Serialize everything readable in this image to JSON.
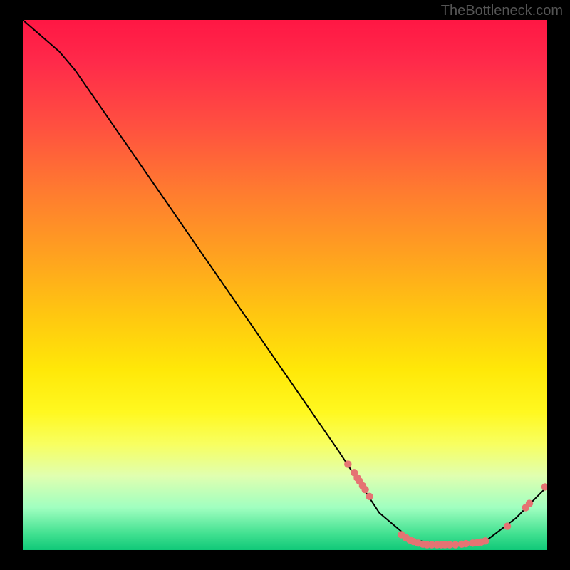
{
  "watermark": "TheBottleneck.com",
  "chart_data": {
    "type": "line",
    "title": "",
    "xlabel": "",
    "ylabel": "",
    "xlim": [
      0,
      100
    ],
    "ylim": [
      0,
      100
    ],
    "line": [
      {
        "x": 0,
        "y": 100
      },
      {
        "x": 7,
        "y": 94
      },
      {
        "x": 10,
        "y": 90.5
      },
      {
        "x": 60,
        "y": 19
      },
      {
        "x": 68,
        "y": 7
      },
      {
        "x": 74,
        "y": 2
      },
      {
        "x": 80,
        "y": 1
      },
      {
        "x": 88,
        "y": 1.5
      },
      {
        "x": 94,
        "y": 6
      },
      {
        "x": 98,
        "y": 10
      },
      {
        "x": 100,
        "y": 12
      }
    ],
    "points": [
      {
        "x": 62.0,
        "y": 16.2
      },
      {
        "x": 63.2,
        "y": 14.6
      },
      {
        "x": 63.8,
        "y": 13.6
      },
      {
        "x": 64.2,
        "y": 13.0
      },
      {
        "x": 64.8,
        "y": 12.1
      },
      {
        "x": 65.3,
        "y": 11.4
      },
      {
        "x": 66.1,
        "y": 10.1
      },
      {
        "x": 72.2,
        "y": 2.9
      },
      {
        "x": 73.1,
        "y": 2.3
      },
      {
        "x": 73.8,
        "y": 1.9
      },
      {
        "x": 74.5,
        "y": 1.6
      },
      {
        "x": 75.4,
        "y": 1.3
      },
      {
        "x": 76.3,
        "y": 1.1
      },
      {
        "x": 77.1,
        "y": 1.0
      },
      {
        "x": 78.0,
        "y": 1.0
      },
      {
        "x": 79.0,
        "y": 1.0
      },
      {
        "x": 79.8,
        "y": 1.0
      },
      {
        "x": 80.5,
        "y": 1.0
      },
      {
        "x": 81.4,
        "y": 1.0
      },
      {
        "x": 82.5,
        "y": 1.0
      },
      {
        "x": 83.7,
        "y": 1.1
      },
      {
        "x": 84.5,
        "y": 1.2
      },
      {
        "x": 85.8,
        "y": 1.3
      },
      {
        "x": 86.7,
        "y": 1.4
      },
      {
        "x": 87.4,
        "y": 1.5
      },
      {
        "x": 88.2,
        "y": 1.7
      },
      {
        "x": 92.4,
        "y": 4.5
      },
      {
        "x": 95.9,
        "y": 8.0
      },
      {
        "x": 96.6,
        "y": 8.8
      },
      {
        "x": 99.6,
        "y": 11.9
      }
    ],
    "point_color": "#e57373",
    "line_color": "#000000"
  }
}
